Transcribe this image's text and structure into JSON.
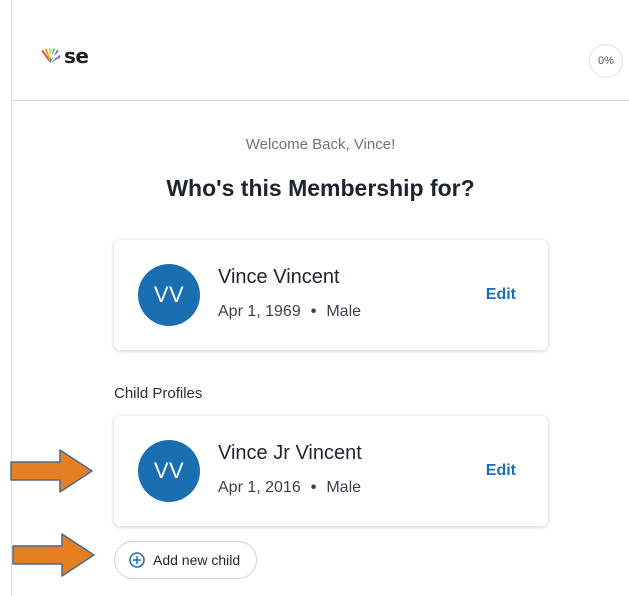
{
  "header": {
    "logo_text": "se",
    "progress": "0%"
  },
  "main": {
    "welcome": "Welcome Back, Vince!",
    "question": "Who's this Membership for?",
    "primary_profile": {
      "initials": "VV",
      "name": "Vince Vincent",
      "birthdate": "Apr 1, 1969",
      "separator": "•",
      "gender": "Male",
      "edit_label": "Edit"
    },
    "child_section_label": "Child Profiles",
    "child_profiles": [
      {
        "initials": "VV",
        "name": "Vince Jr Vincent",
        "birthdate": "Apr 1, 2016",
        "separator": "•",
        "gender": "Male",
        "edit_label": "Edit"
      }
    ],
    "add_child_label": "Add new child"
  },
  "colors": {
    "accent": "#1a6fb3",
    "arrow": "#e67e22"
  },
  "icons": {
    "logo": "peacock-icon",
    "add": "plus-circle-icon",
    "annotation": "arrow-right-icon"
  }
}
